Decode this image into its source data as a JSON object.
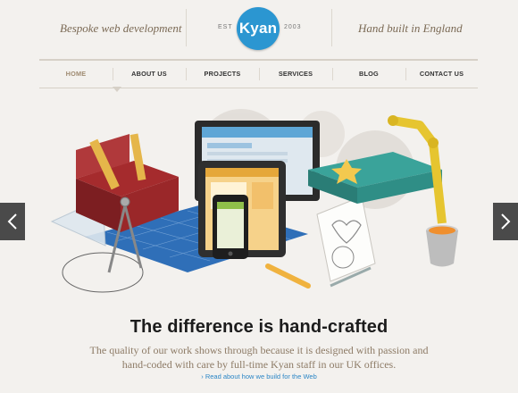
{
  "header": {
    "tagline_left": "Bespoke web development",
    "tagline_right": "Hand built in England",
    "logo": {
      "text": "Kyan",
      "est_label": "EST",
      "year": "2003",
      "color": "#2b96d1"
    }
  },
  "nav": {
    "items": [
      {
        "label": "HOME",
        "active": true
      },
      {
        "label": "ABOUT US",
        "active": false
      },
      {
        "label": "PROJECTS",
        "active": false
      },
      {
        "label": "SERVICES",
        "active": false
      },
      {
        "label": "BLOG",
        "active": false
      },
      {
        "label": "CONTACT US",
        "active": false
      }
    ]
  },
  "hero": {
    "prev_icon": "chevron-left-icon",
    "next_icon": "chevron-right-icon"
  },
  "content": {
    "headline": "The difference is hand-crafted",
    "description": "The quality of our work shows through because it is designed with passion and hand-coded with care by full-time Kyan staff in our UK offices.",
    "read_more": "› Read about how we build for the Web"
  }
}
